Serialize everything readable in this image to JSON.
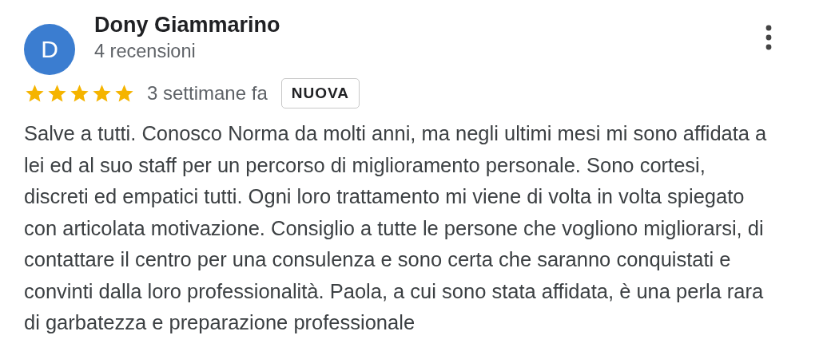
{
  "review": {
    "avatar_letter": "D",
    "author": "Dony Giammarino",
    "review_count": "4 recensioni",
    "stars": 5,
    "time": "3 settimane fa",
    "badge": "NUOVA",
    "text": "Salve a tutti. Conosco Norma da molti anni, ma negli ultimi mesi mi sono affidata a lei ed al suo staff per un percorso di miglioramento personale. Sono cortesi, discreti ed empatici tutti. Ogni loro trattamento mi viene di volta in volta spiegato con articolata motivazione. Consiglio a tutte le persone che vogliono migliorarsi, di contattare il centro per una consulenza e sono certa che saranno conquistati e convinti dalla loro professionalità. Paola, a cui sono stata affidata, è una perla rara di garbatezza e preparazione professionale"
  }
}
